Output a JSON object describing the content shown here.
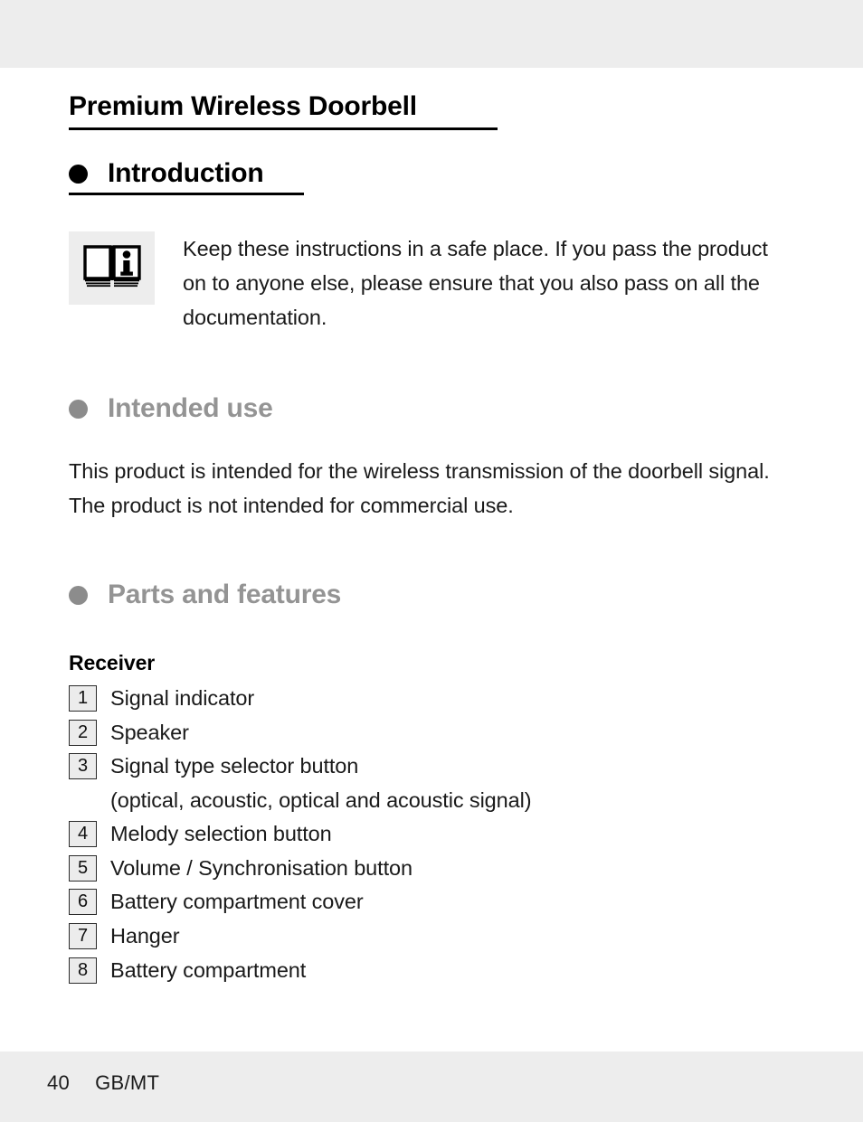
{
  "document": {
    "title": "Premium Wireless Doorbell"
  },
  "sections": {
    "introduction": {
      "heading": "Introduction",
      "bullet_color": "#000000",
      "heading_color": "#000000",
      "note_icon": "open-book-info-icon",
      "note_text": "Keep these instructions in a safe place. If you pass the product on to anyone else, please ensure that you also pass on all the documentation."
    },
    "intended_use": {
      "heading": "Intended use",
      "bullet_color": "#8c8c8c",
      "heading_color": "#949494",
      "paragraph": "This product is intended for the wireless transmission of the doorbell signal. The product is not intended for commercial use."
    },
    "parts_and_features": {
      "heading": "Parts and features",
      "bullet_color": "#8c8c8c",
      "heading_color": "#949494",
      "subheading": "Receiver",
      "items": [
        {
          "number": "1",
          "label": "Signal indicator"
        },
        {
          "number": "2",
          "label": "Speaker"
        },
        {
          "number": "3",
          "label": "Signal type selector button"
        },
        {
          "number": "",
          "label": "(optical, acoustic, optical and acoustic signal)"
        },
        {
          "number": "4",
          "label": "Melody selection button"
        },
        {
          "number": "5",
          "label": "Volume / Synchronisation button"
        },
        {
          "number": "6",
          "label": "Battery compartment cover"
        },
        {
          "number": "7",
          "label": "Hanger"
        },
        {
          "number": "8",
          "label": "Battery compartment"
        }
      ]
    }
  },
  "footer": {
    "page_number": "40",
    "language_code": "GB/MT"
  },
  "colors": {
    "band_background": "#ededed",
    "number_box_fill": "#ececec",
    "number_box_border": "#2b2b2b",
    "text": "#1a1a1a",
    "gray_heading": "#949494"
  }
}
